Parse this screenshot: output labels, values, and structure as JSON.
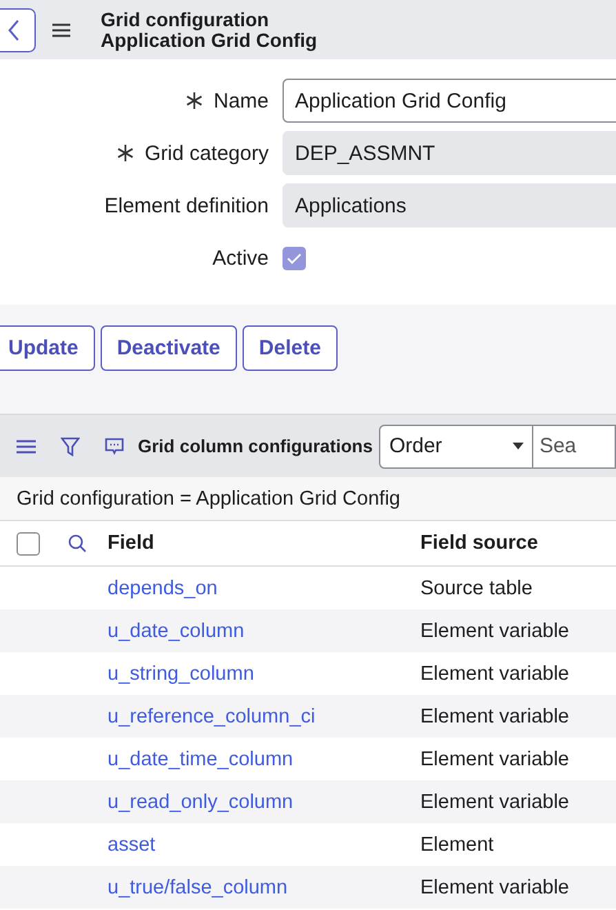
{
  "header": {
    "title": "Grid configuration",
    "subtitle": "Application Grid Config"
  },
  "form": {
    "fields": [
      {
        "kind": "text",
        "label": "Name",
        "required": true,
        "readonly": false,
        "value": "Application Grid Config"
      },
      {
        "kind": "text",
        "label": "Grid category",
        "required": true,
        "readonly": true,
        "value": "DEP_ASSMNT"
      },
      {
        "kind": "text",
        "label": "Element definition",
        "required": false,
        "readonly": true,
        "value": "Applications"
      },
      {
        "kind": "checkbox",
        "label": "Active",
        "checked": true
      }
    ]
  },
  "actions": [
    "Update",
    "Deactivate",
    "Delete"
  ],
  "list": {
    "title": "Grid column configurations",
    "sort_field": {
      "value": "Order"
    },
    "search": {
      "placeholder": "Sea"
    },
    "filter": "Grid configuration = Application Grid Config",
    "select_all": {
      "checked": false
    },
    "columns": [
      "Field",
      "Field source"
    ],
    "rows": [
      {
        "field": "depends_on",
        "source": "Source table"
      },
      {
        "field": "u_date_column",
        "source": "Element variable"
      },
      {
        "field": "u_string_column",
        "source": "Element variable"
      },
      {
        "field": "u_reference_column_ci",
        "source": "Element variable"
      },
      {
        "field": "u_date_time_column",
        "source": "Element variable"
      },
      {
        "field": "u_read_only_column",
        "source": "Element variable"
      },
      {
        "field": "asset",
        "source": "Element"
      },
      {
        "field": "u_true/false_column",
        "source": "Element variable"
      }
    ]
  }
}
